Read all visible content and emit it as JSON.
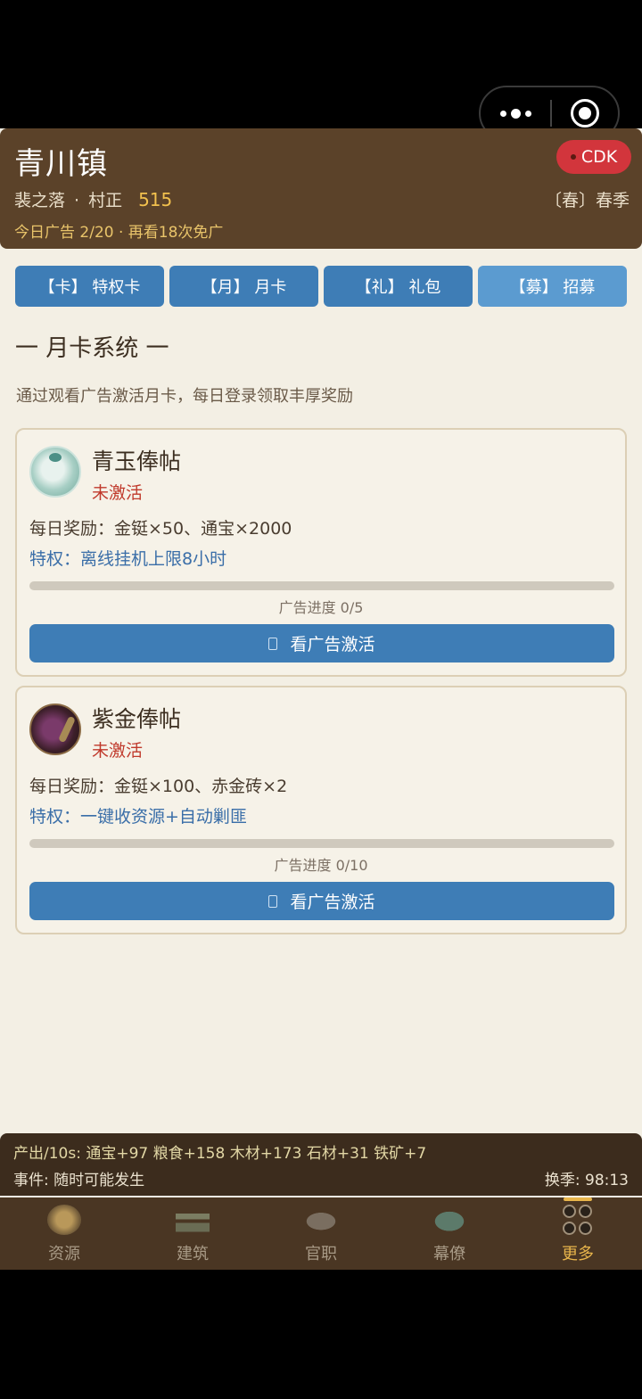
{
  "header": {
    "town": "青川镇",
    "cdk_label": "CDK",
    "place": "裴之落",
    "dot": "·",
    "rank": "村正",
    "score": "515",
    "season": "〔春〕春季",
    "ad_info": "今日广告 2/20 · 再看18次免广"
  },
  "tabs": [
    {
      "label": "【卡】 特权卡"
    },
    {
      "label": "【月】 月卡"
    },
    {
      "label": "【礼】 礼包"
    },
    {
      "label": "【募】 招募",
      "active": true
    }
  ],
  "section": {
    "title": "一 月卡系统 一",
    "desc": "通过观看广告激活月卡，每日登录领取丰厚奖励"
  },
  "cards": [
    {
      "icon": "jade-seal-icon",
      "name": "青玉俸帖",
      "status": "未激活",
      "reward": "每日奖励：金铤×50、通宝×2000",
      "privilege": "特权：离线挂机上限8小时",
      "progress_text": "广告进度 0/5",
      "progress": 0,
      "button": "看广告激活"
    },
    {
      "icon": "gold-seal-icon",
      "name": "紫金俸帖",
      "status": "未激活",
      "reward": "每日奖励：金铤×100、赤金砖×2",
      "privilege": "特权：一键收资源+自动剿匪",
      "progress_text": "广告进度 0/10",
      "progress": 0,
      "button": "看广告激活"
    }
  ],
  "status_bar": {
    "production": "产出/10s: 通宝+97 粮食+158 木材+173 石材+31 铁矿+7",
    "event": "事件: 随时可能发生",
    "season_timer": "换季: 98:13"
  },
  "nav": [
    {
      "label": "资源",
      "icon": "resources-icon"
    },
    {
      "label": "建筑",
      "icon": "building-icon"
    },
    {
      "label": "官职",
      "icon": "official-hat-icon"
    },
    {
      "label": "幕僚",
      "icon": "fan-icon"
    },
    {
      "label": "更多",
      "icon": "more-grid-icon",
      "active": true
    }
  ],
  "colors": {
    "header_bg": "#5b4229",
    "tab_blue": "#3e7db6",
    "accent_gold": "#e8b54b",
    "status_red": "#c0392b"
  }
}
